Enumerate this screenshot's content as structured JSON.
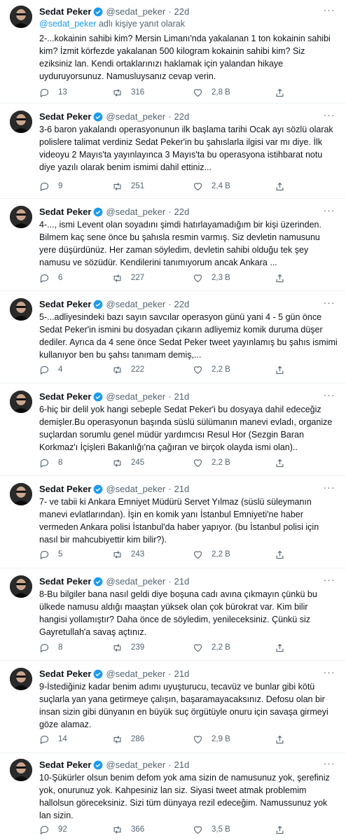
{
  "reply_context": {
    "prefix": "@sedat_peker",
    "suffix": "adlı kişiye yanıt olarak"
  },
  "colors": {
    "accent": "#1d9bf0",
    "muted": "#536471",
    "text": "#0f1419"
  },
  "tweets": [
    {
      "name": "Sedat Peker",
      "handle": "@sedat_peker",
      "dot": "·",
      "time": "22d",
      "text": "2-...kokainin sahibi kim? Mersin Limanı'nda yakalanan 1 ton kokainin sahibi kim? İzmit körfezde yakalanan 500 kilogram kokainin sahibi kim? Siz eziksiniz lan. Kendi ortaklarınızı haklamak için yalandan hikaye uyduruyorsunuz. Namusluysanız cevap verin.",
      "replies": "13",
      "retweets": "316",
      "likes": "2,8 B"
    },
    {
      "name": "Sedat Peker",
      "handle": "@sedat_peker",
      "dot": "·",
      "time": "22d",
      "text": "3-6 baron yakalandı operasyonunun ilk başlama tarihi Ocak ayı sözlü olarak polislere talimat verdiniz Sedat Peker'in bu şahıslarla ilgisi var mı diye. İlk videoyu 2 Mayıs'ta yayınlayınca 3 Mayıs'ta bu operasyona istihbarat notu diye yazılı olarak benim ismimi dahil ettiniz...",
      "replies": "9",
      "retweets": "251",
      "likes": "2,4 B"
    },
    {
      "name": "Sedat Peker",
      "handle": "@sedat_peker",
      "dot": "·",
      "time": "22d",
      "text": "4-..., ismi Levent olan soyadını şimdi hatırlayamadığım bir kişi üzerinden.  Bilmem kaç sene önce bu şahısla resmin varmış. Siz devletin namusunu yere düşürdünüz. Her zaman söyledim, devletin sahibi olduğu tek şey namusu ve sözüdür. Kendilerini tanımıyorum ancak Ankara ...",
      "replies": "6",
      "retweets": "227",
      "likes": "2,3 B"
    },
    {
      "name": "Sedat Peker",
      "handle": "@sedat_peker",
      "dot": "·",
      "time": "22d",
      "text": "5-...adliyesindeki bazı sayın savcılar operasyon günü yani 4 - 5 gün önce Sedat Peker'in ismini bu dosyadan çıkarın adliyemiz komik duruma düşer dediler. Ayrıca da 4 sene önce Sedat Peker tweet yayınlamış bu şahıs ismimi kullanıyor ben bu şahsı tanımam demiş,...",
      "replies": "4",
      "retweets": "222",
      "likes": "2,2 B"
    },
    {
      "name": "Sedat Peker",
      "handle": "@sedat_peker",
      "dot": "·",
      "time": "21d",
      "text": "6-hiç bir delil yok hangi sebeple Sedat Peker'i bu dosyaya dahil edeceğiz demişler.Bu operasyonun başında süslü sülümanın manevi evladı, organize suçlardan sorumlu genel müdür yardımcısı Resul Hor (Sezgin Baran Korkmaz'ı İçişleri Bakanlığı'na çağıran ve birçok olayda ismi olan)..",
      "replies": "8",
      "retweets": "245",
      "likes": "2,2 B"
    },
    {
      "name": "Sedat Peker",
      "handle": "@sedat_peker",
      "dot": "·",
      "time": "21d",
      "text": "7- ve tabii ki Ankara Emniyet Müdürü Servet Yılmaz (süslü süleymanın manevi evlatlarından). İşin en komik yanı İstanbul Emniyeti'ne haber vermeden Ankara polisi İstanbul'da haber yapıyor.  (bu İstanbul polisi için nasıl bir mahcubiyettir kim bilir?).",
      "replies": "5",
      "retweets": "243",
      "likes": "2,2 B"
    },
    {
      "name": "Sedat Peker",
      "handle": "@sedat_peker",
      "dot": "·",
      "time": "21d",
      "text": "8-Bu bilgiler bana nasıl geldi diye boşuna cadı avına çıkmayın çünkü bu ülkede namusu aldığı maaştan yüksek olan çok bürokrat var. Kim bilir hangisi yollamıştır? Daha önce de söyledim, yenileceksiniz. Çünkü siz Gayretullah'a savaş açtınız.",
      "replies": "8",
      "retweets": "239",
      "likes": "2,2 B"
    },
    {
      "name": "Sedat Peker",
      "handle": "@sedat_peker",
      "dot": "·",
      "time": "21d",
      "text": "9-İstediğiniz kadar benim adımı uyuşturucu, tecavüz ve bunlar gibi kötü suçlarla yan yana getirmeye çalışın, başaramayacaksınız. Defosu olan bir insan sizin gibi dünyanın en büyük suç örgütüyle onuru için savaşa girmeyi göze alamaz.",
      "replies": "14",
      "retweets": "286",
      "likes": "2,9 B"
    },
    {
      "name": "Sedat Peker",
      "handle": "@sedat_peker",
      "dot": "·",
      "time": "21d",
      "text": "10-Şükürler olsun benim defom yok ama sizin de namusunuz yok, şerefiniz yok, onurunuz yok. Kahpesiniz lan siz. Siyasi tweet atmak problemim hallolsun göreceksiniz. Sizi tüm dünyaya rezil edeceğim. Namussunuz yok lan sizin.",
      "replies": "92",
      "retweets": "366",
      "likes": "3,5 B"
    }
  ]
}
